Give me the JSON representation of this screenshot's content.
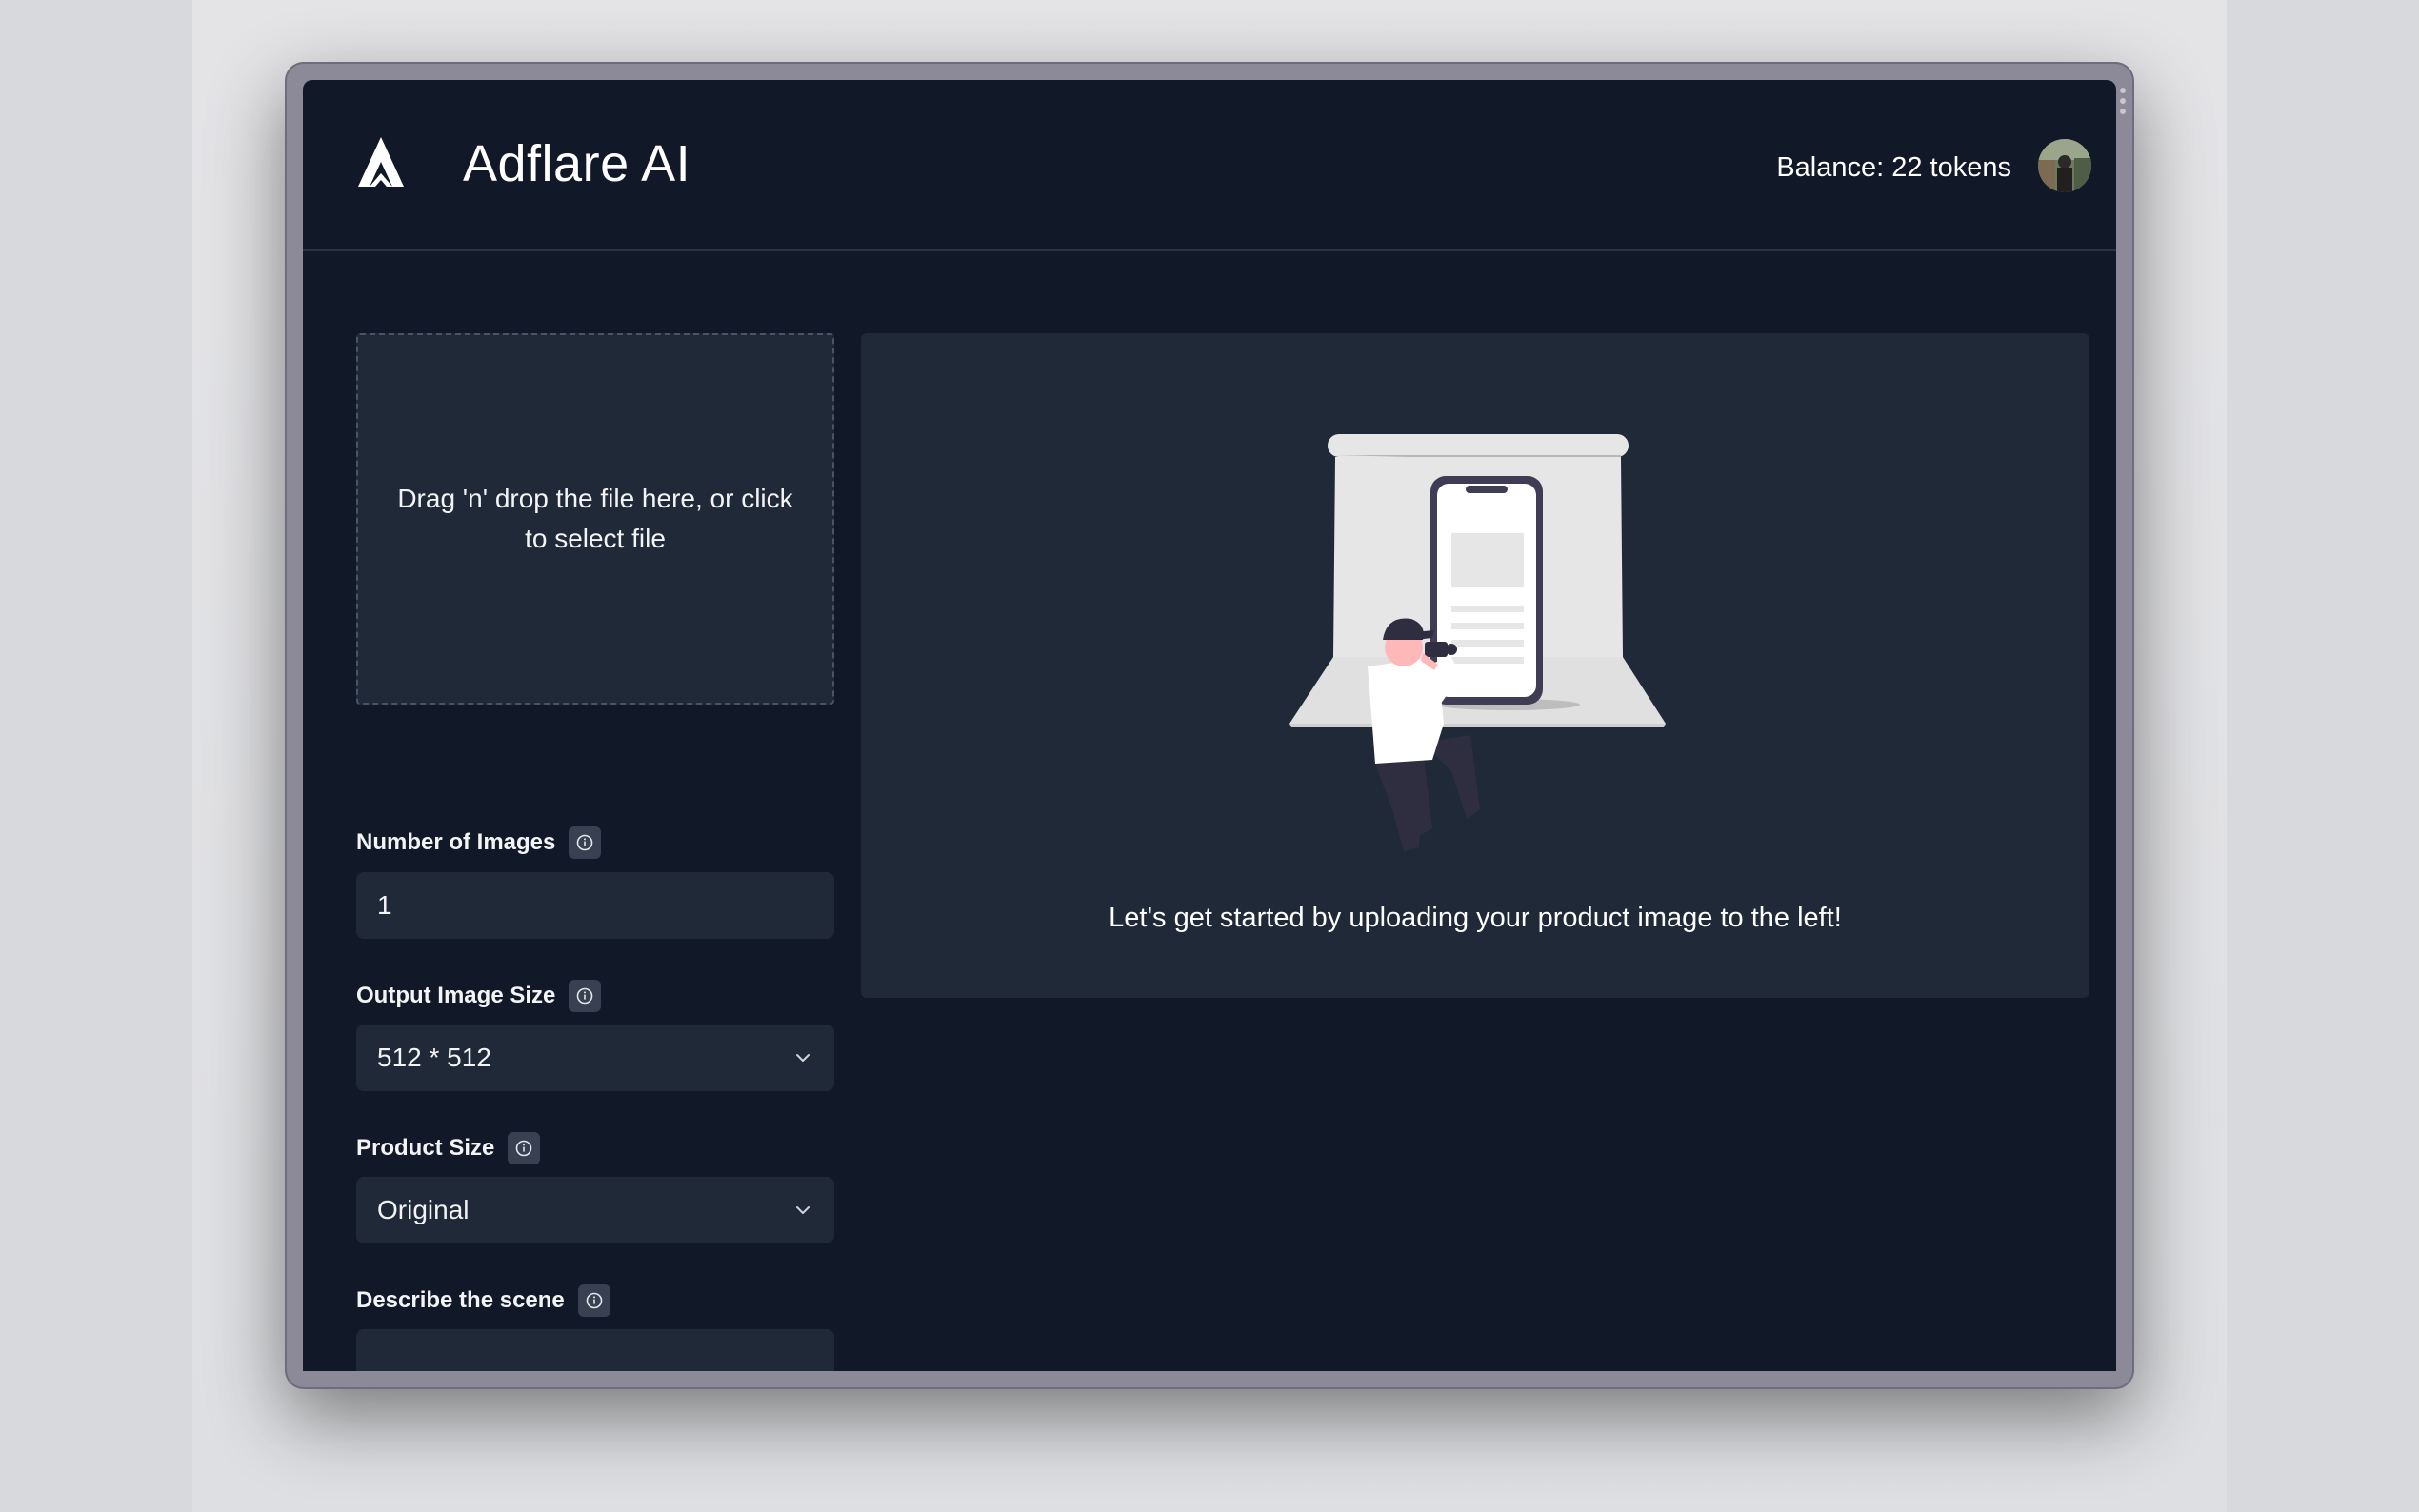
{
  "header": {
    "title": "Adflare AI",
    "balance": "Balance: 22 tokens"
  },
  "upload": {
    "prompt": "Drag 'n' drop the file here, or click to select file"
  },
  "form": {
    "num_images": {
      "label": "Number of Images",
      "value": "1"
    },
    "output_size": {
      "label": "Output Image Size",
      "value": "512 * 512"
    },
    "product_size": {
      "label": "Product Size",
      "value": "Original"
    },
    "scene": {
      "label": "Describe the scene",
      "value": ""
    }
  },
  "preview": {
    "message": "Let's get started by uploading your product image to the left!"
  },
  "colors": {
    "app_bg": "#111827",
    "panel_bg": "#1f2937",
    "info_bg": "#374151",
    "text": "#f3f4f6"
  },
  "icons": {
    "logo": "adflare-logo",
    "info": "info-icon",
    "chevron": "chevron-down-icon"
  }
}
